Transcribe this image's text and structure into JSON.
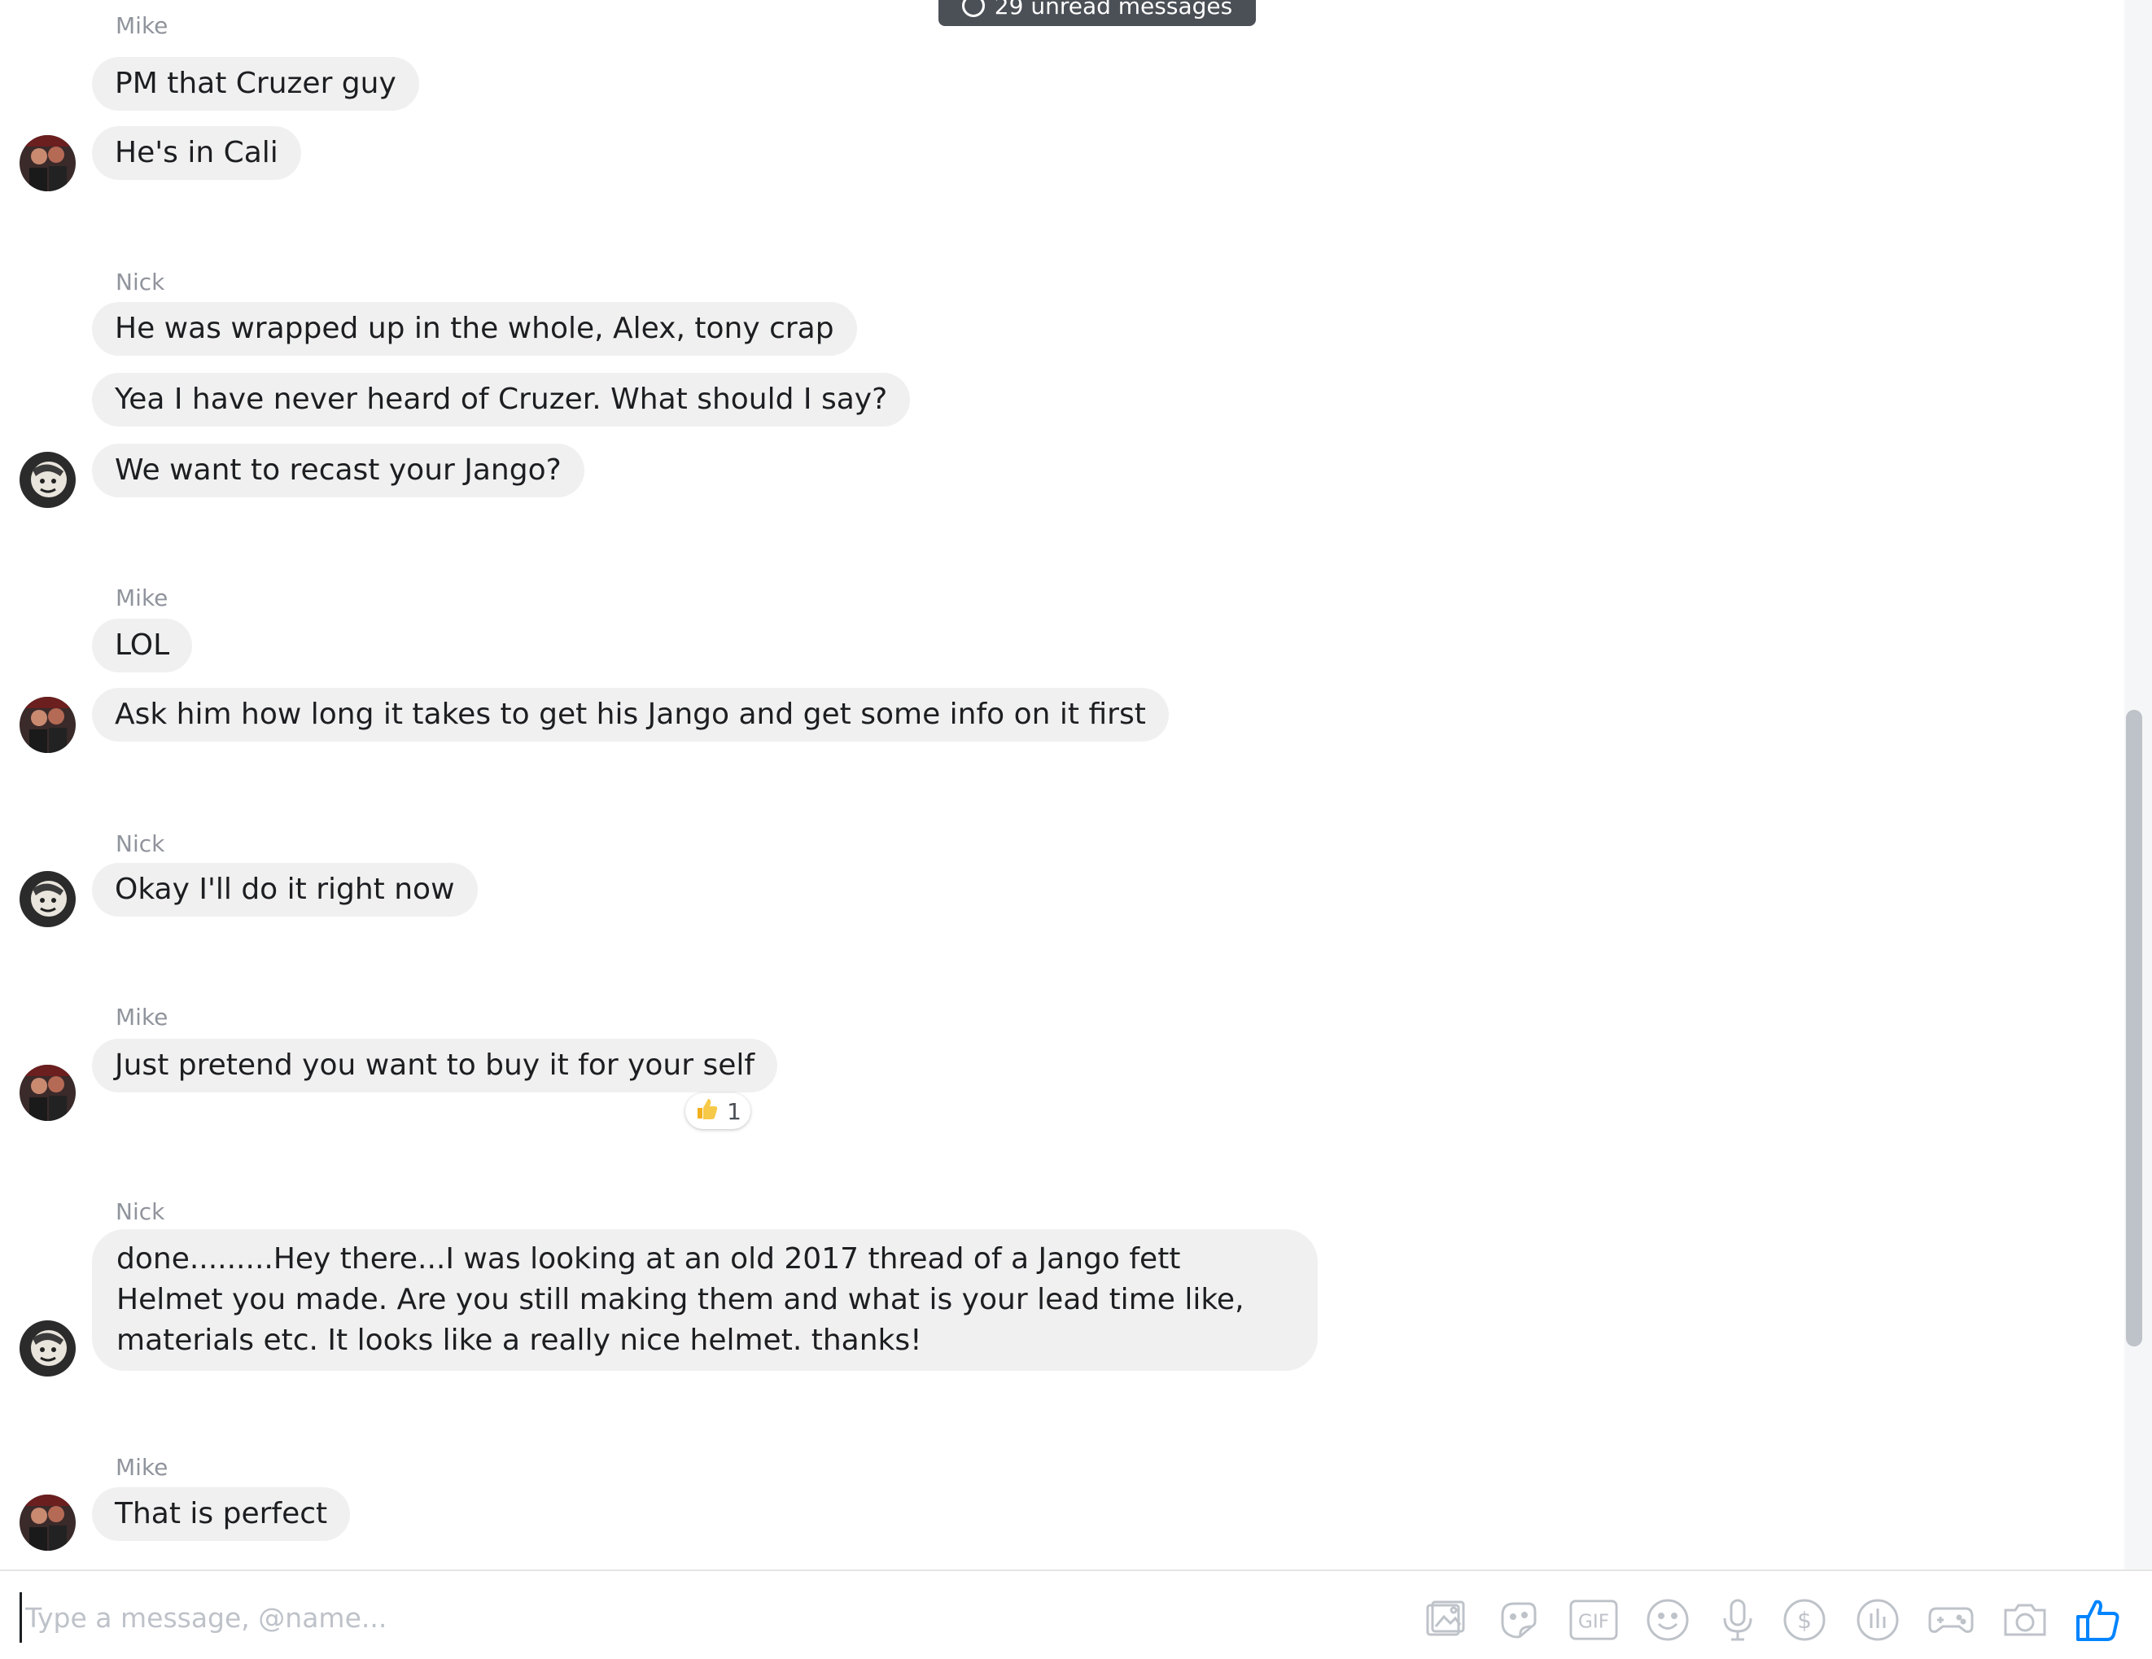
{
  "unread_banner": {
    "text": "29 unread messages",
    "icon": "clock-icon"
  },
  "messages": [
    {
      "sender": "Mike",
      "lines": [
        "PM that Cruzer guy",
        "He's in Cali"
      ]
    },
    {
      "sender": "Nick",
      "lines": [
        "He was wrapped up in the whole, Alex, tony crap",
        "Yea I have never heard of Cruzer. What should I say?",
        "We want to recast your Jango?"
      ]
    },
    {
      "sender": "Mike",
      "lines": [
        "LOL",
        "Ask him how long it takes to get his Jango and get some info on it first"
      ]
    },
    {
      "sender": "Nick",
      "lines": [
        "Okay I'll do it right now"
      ]
    },
    {
      "sender": "Mike",
      "lines": [
        "Just pretend you want to buy it for your self"
      ],
      "reaction": {
        "icon": "thumbs-up-emoji",
        "count": "1"
      }
    },
    {
      "sender": "Nick",
      "lines": [
        "done.........Hey there...I was looking at an old 2017 thread of a Jango fett Helmet you made. Are you still making them and what is your lead time like, materials etc. It looks like a really nice helmet. thanks!"
      ]
    },
    {
      "sender": "Mike",
      "lines": [
        "That is perfect"
      ]
    }
  ],
  "composer": {
    "placeholder": "Type a message, @name...",
    "value": "",
    "tools": [
      "photo-icon",
      "sticker-icon",
      "gif-icon",
      "emoji-icon",
      "microphone-icon",
      "payment-icon",
      "poll-icon",
      "game-icon",
      "camera-icon",
      "like-icon"
    ]
  },
  "colors": {
    "bubble": "#f1f0f0",
    "accent": "#0084ff",
    "sender_name": "#90949c"
  }
}
